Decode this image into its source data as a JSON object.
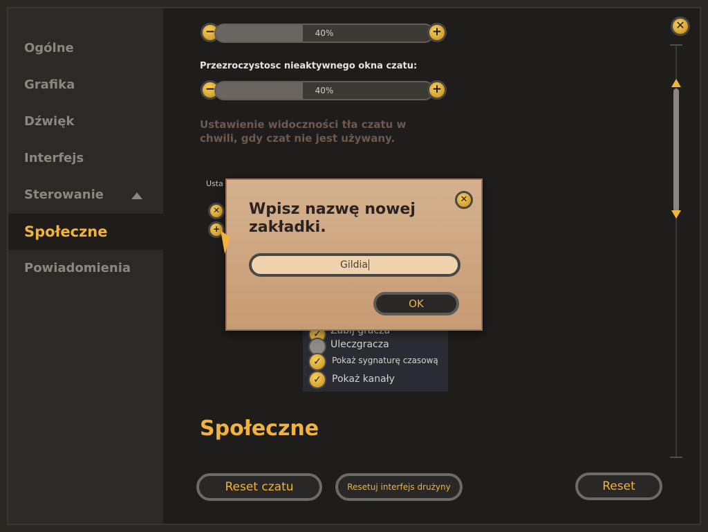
{
  "sidebar": {
    "items": [
      {
        "label": "Ogólne"
      },
      {
        "label": "Grafika"
      },
      {
        "label": "Dźwięk"
      },
      {
        "label": "Interfejs"
      },
      {
        "label": "Sterowanie"
      },
      {
        "label": "Społeczne"
      },
      {
        "label": "Powiadomienia"
      }
    ]
  },
  "top_slider": {
    "value_text": "40%",
    "value": 0.4
  },
  "opacity": {
    "label": "Przezroczystosc nieaktywnego okna czatu:",
    "value_text": "40%",
    "value": 0.4,
    "description": "Ustawienie widoczności tła czatu w chwili, gdy czat nie jest używany."
  },
  "chat_settings_label": "Usta",
  "options": [
    {
      "label": "Zabij gracza",
      "checked": true
    },
    {
      "label": "Uleczgracza",
      "checked": false
    },
    {
      "label": "Pokaż sygnaturę czasową",
      "checked": true
    },
    {
      "label": "Pokaż kanały",
      "checked": true
    }
  ],
  "section_heading": "Społeczne",
  "buttons": {
    "reset_chat": "Reset czatu",
    "reset_team": "Resetuj interfejs drużyny",
    "reset": "Reset"
  },
  "dialog": {
    "title": "Wpisz nazwę nowej zakładki.",
    "input_value": "Gildia",
    "ok": "OK"
  },
  "colors": {
    "accent": "#f0b33c",
    "parchment": "#d4b18f"
  }
}
